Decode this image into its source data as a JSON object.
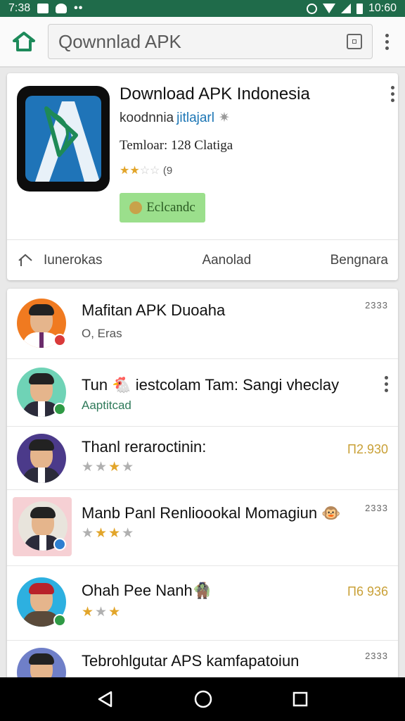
{
  "status_bar": {
    "time": "7:38",
    "clock_right": "10:60"
  },
  "browser": {
    "url_text": "Qownnlad APK"
  },
  "app": {
    "title": "Download APK Indonesia",
    "developer": "koodnnia",
    "developer_link": "jitlajarl",
    "downloads": "Temloar: 128 Clatiga",
    "rating_text": "(9",
    "rating_stars": 2,
    "install_label": "Eclcandc",
    "tabs": [
      "Iunerokas",
      "Aanolad",
      "Bengnara"
    ]
  },
  "list": [
    {
      "title": "Mafitan APK Duoaha",
      "subtitle": "O, Eras",
      "meta": "2333"
    },
    {
      "title": "Tun 🐔 iestcolam Tam: Sangi vheclay",
      "subtitle": "Aaptitcad"
    },
    {
      "title": "Thanl reraroctinin:",
      "price": "П2.930",
      "stars": 3
    },
    {
      "title": "Manb Panl Renlioookal Momagiun 🐵",
      "meta": "2333",
      "stars": 3
    },
    {
      "title": "Ohah Pee Nanh🧌",
      "price": "Π6 936",
      "stars": 3
    },
    {
      "title": "Tebrohlgutar APS kamfapatoiun",
      "meta": "2333"
    }
  ],
  "colors": {
    "status_bar": "#1f6b4a",
    "accent_green": "#1d8a5a",
    "install_bg": "#9bdf8c",
    "price_gold": "#c9a036",
    "star_gold": "#e2a52a"
  },
  "icons": [
    "home-icon",
    "tab-switcher-icon",
    "overflow-menu-icon",
    "back-icon",
    "nav-home-icon",
    "recents-icon"
  ]
}
